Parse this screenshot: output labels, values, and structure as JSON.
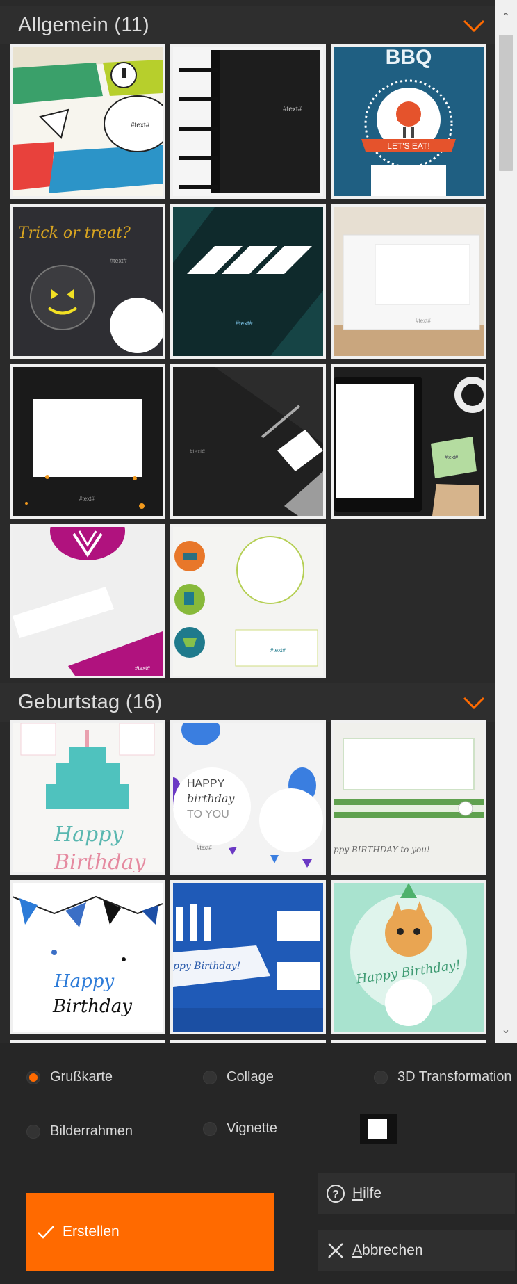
{
  "sections": [
    {
      "title": "Allgemein (11)",
      "collapse_icon": "chevron-down-icon"
    },
    {
      "title": "Geburtstag (16)",
      "collapse_icon": "chevron-down-icon"
    }
  ],
  "thumbnails": {
    "allgemein": [
      {
        "name": "comic-card",
        "text": "#text#"
      },
      {
        "name": "black-notebook",
        "text": "#text#"
      },
      {
        "name": "bbq-card",
        "title": "BBQ",
        "subtitle": "LET'S EAT!"
      },
      {
        "name": "halloween-card",
        "title": "Trick or treat?",
        "text": "#text#"
      },
      {
        "name": "green-stripes",
        "text": "#text#"
      },
      {
        "name": "paper-on-desk",
        "text": "#text#"
      },
      {
        "name": "sparkle-frame",
        "text": "#text#"
      },
      {
        "name": "dark-desk-card",
        "text": "#text#"
      },
      {
        "name": "tablet-coffee",
        "text": "#text#"
      },
      {
        "name": "magenta-card",
        "text": "#text#"
      },
      {
        "name": "shopping-icons",
        "text": "#text#"
      }
    ],
    "geburtstag": [
      {
        "name": "birthday-cake",
        "title": "Happy",
        "title2": "Birthday"
      },
      {
        "name": "balloons-card",
        "line1": "HAPPY",
        "line2": "birthday",
        "line3": "TO YOU",
        "text": "#text#"
      },
      {
        "name": "green-ribbon",
        "caption": "ppy BIRTHDAY to you!"
      },
      {
        "name": "bunting-card",
        "line1": "Happy",
        "line2": "Birthday"
      },
      {
        "name": "blue-candles",
        "caption": "ppy Birthday!"
      },
      {
        "name": "cat-card",
        "caption": "Happy Birthday!"
      }
    ]
  },
  "options": {
    "grusskarte": "Grußkarte",
    "collage": "Collage",
    "transformation": "3D Transformation",
    "bilderrahmen": "Bilderrahmen",
    "vignette": "Vignette",
    "selected": "grusskarte"
  },
  "buttons": {
    "create": "Erstellen",
    "help_prefix": "",
    "help_hotkey": "H",
    "help_rest": "ilfe",
    "cancel_hotkey": "A",
    "cancel_rest": "bbrechen"
  },
  "colors": {
    "accent": "#ff6a00",
    "background": "#222222"
  }
}
